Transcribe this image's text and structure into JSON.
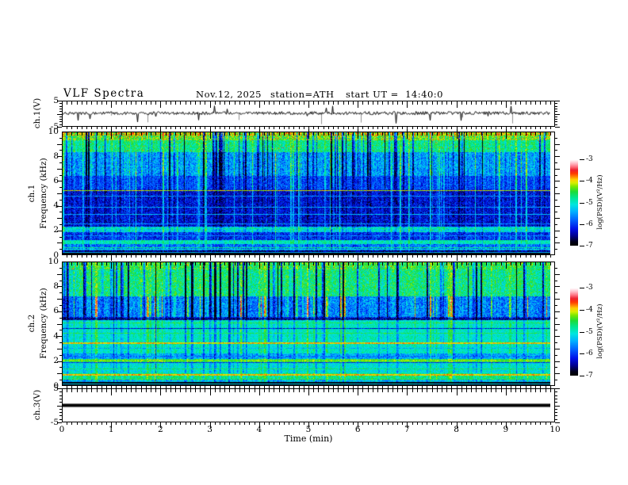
{
  "header": {
    "title": "VLF Spectra",
    "date": "Nov.12, 2025",
    "station": "station=ATH",
    "start_ut": "start UT =  14:40:0"
  },
  "x_axis": {
    "label": "Time (min)",
    "min": 0,
    "max": 10,
    "ticks": [
      "0",
      "1",
      "2",
      "3",
      "4",
      "5",
      "6",
      "7",
      "8",
      "9",
      "10"
    ],
    "minor_step_min": 0.1
  },
  "colormap": {
    "vmin": -7,
    "vmax": -3,
    "stops": [
      {
        "t": 0.0,
        "c": "#000000"
      },
      {
        "t": 0.05,
        "c": "#000018"
      },
      {
        "t": 0.12,
        "c": "#000090"
      },
      {
        "t": 0.2,
        "c": "#0010e8"
      },
      {
        "t": 0.3,
        "c": "#0060ff"
      },
      {
        "t": 0.4,
        "c": "#00b2ff"
      },
      {
        "t": 0.48,
        "c": "#00e6e0"
      },
      {
        "t": 0.56,
        "c": "#00e690"
      },
      {
        "t": 0.63,
        "c": "#1ddc35"
      },
      {
        "t": 0.69,
        "c": "#7ae800"
      },
      {
        "t": 0.73,
        "c": "#d6ef00"
      },
      {
        "t": 0.77,
        "c": "#ffd000"
      },
      {
        "t": 0.8,
        "c": "#ff8c00"
      },
      {
        "t": 0.84,
        "c": "#ff3800"
      },
      {
        "t": 0.88,
        "c": "#ee1f2e"
      },
      {
        "t": 0.92,
        "c": "#ff7584"
      },
      {
        "t": 0.96,
        "c": "#ffc0cb"
      },
      {
        "t": 1.0,
        "c": "#ffffff"
      }
    ]
  },
  "colorbars": [
    {
      "label": "log(PSD)(V²/Hz)",
      "ticks": [
        "-3",
        "-4",
        "-5",
        "-6",
        "-7"
      ]
    },
    {
      "label": "log(PSD)(V²/Hz)",
      "ticks": [
        "-3",
        "-4",
        "-5",
        "-6",
        "-7"
      ]
    }
  ],
  "chart_data": [
    {
      "type": "line",
      "name": "ch1 voltage waveform",
      "ylabel": "ch.1(V)",
      "ylim": [
        -5,
        5
      ],
      "y_tick_labels": [
        {
          "v": 5,
          "label": "5"
        },
        {
          "v": -5,
          "label": "-5"
        }
      ],
      "x_range_min": [
        0,
        9.89
      ],
      "signal": {
        "seed": 7,
        "baseline": 0.25,
        "noise_amplitude": 0.65,
        "spike_down_prob": 0.012,
        "spike_down_max": 4.3,
        "spike_up_prob": 0.006,
        "spike_up_max": 2.4,
        "gray_spike_prob": 0.01,
        "gray_spike_max": 3.2,
        "line_color": "#000000",
        "gray_color": "#909090"
      }
    },
    {
      "type": "heatmap",
      "name": "ch1 spectrogram",
      "ylabel": [
        "ch.1",
        "Frequency (kHz)"
      ],
      "ylim": [
        0,
        10
      ],
      "freq_max": 10,
      "y_tick_labels": [
        {
          "v": 10,
          "label": "10"
        },
        {
          "v": 8,
          "label": "8"
        },
        {
          "v": 6,
          "label": "6"
        },
        {
          "v": 4,
          "label": "4"
        },
        {
          "v": 2,
          "label": "2"
        },
        {
          "v": 0,
          "label": "0"
        }
      ],
      "zlabel": "log(PSD)(V²/Hz)",
      "zlim": [
        -7,
        -3
      ],
      "seed": 1234,
      "streaks": {
        "probability": 0.34,
        "max_width": 2,
        "max_strength": 2.3,
        "dark_fraction": 0.55
      },
      "bands": [
        {
          "f": [
            9.75,
            10.01
          ],
          "base": -4.05,
          "noise": 0.5,
          "sd": -1.15,
          "sb": 0.1,
          "hot": 0.12
        },
        {
          "f": [
            9.35,
            9.75
          ],
          "base": -4.3,
          "noise": 0.45,
          "sd": -1.1,
          "sb": 0.12,
          "hot": 0.05
        },
        {
          "f": [
            8.35,
            9.35
          ],
          "base": -4.7,
          "noise": 0.4,
          "sd": -1.05,
          "sb": 0.15,
          "hot": 0.01
        },
        {
          "f": [
            6.4,
            8.35
          ],
          "base": -5.5,
          "noise": 0.5,
          "sd": -0.8,
          "sb": 0.55
        },
        {
          "f": [
            5.3,
            6.4
          ],
          "base": -5.95,
          "noise": 0.42,
          "sd": -0.35,
          "sb": 0.6
        },
        {
          "f": [
            2.3,
            5.3
          ],
          "base": -6.28,
          "noise": 0.42,
          "sd": -0.18,
          "sb": 0.5
        },
        {
          "f": [
            1.8,
            2.3
          ],
          "base": -5.15,
          "noise": 0.45,
          "sd": -0.3,
          "sb": 0.35
        },
        {
          "f": [
            1.15,
            1.8
          ],
          "base": -6.05,
          "noise": 0.45,
          "sd": -0.15,
          "sb": 0.45
        },
        {
          "f": [
            0.85,
            1.15
          ],
          "base": -4.9,
          "noise": 0.3,
          "sd": -0.2,
          "sb": 0.15
        },
        {
          "f": [
            0.3,
            0.85
          ],
          "base": -5.7,
          "noise": 0.5,
          "sd": -0.2,
          "sb": 0.3
        },
        {
          "f": [
            0.1,
            0.3
          ],
          "base": -6.6,
          "noise": 0.35,
          "sd": 0,
          "sb": 0.2
        },
        {
          "f": [
            -0.01,
            0.1
          ],
          "base": -6.95,
          "noise": 0.08,
          "sd": 0,
          "sb": 0
        }
      ],
      "lines": [
        {
          "f": 5.2,
          "v": -4.1,
          "w": 1,
          "noise": 0.3
        },
        {
          "f": 4.75,
          "v": -5.55,
          "w": 1,
          "noise": 0.3
        },
        {
          "f": 3.85,
          "v": -5.45,
          "w": 1,
          "noise": 0.3
        },
        {
          "f": 3.3,
          "v": -5.35,
          "w": 1,
          "noise": 0.3
        },
        {
          "f": 2.5,
          "v": -5.55,
          "w": 1,
          "noise": 0.3
        },
        {
          "f": 2.1,
          "v": -4.8,
          "w": 1,
          "noise": 0.3
        },
        {
          "f": 1.55,
          "v": -5.6,
          "w": 1,
          "noise": 0.3
        },
        {
          "f": 0.55,
          "v": -4.75,
          "w": 1,
          "noise": 0.3
        },
        {
          "f": 0.42,
          "v": -5.05,
          "w": 1,
          "noise": 0.3
        },
        {
          "f": 0.18,
          "v": -5.4,
          "w": 1,
          "noise": 0.3
        }
      ]
    },
    {
      "type": "heatmap",
      "name": "ch2 spectrogram",
      "ylabel": [
        "ch.2",
        "Frequency (kHz)"
      ],
      "ylim": [
        0,
        10
      ],
      "freq_max": 10,
      "y_tick_labels": [
        {
          "v": 10,
          "label": "10"
        },
        {
          "v": 8,
          "label": "8"
        },
        {
          "v": 6,
          "label": "6"
        },
        {
          "v": 4,
          "label": "4"
        },
        {
          "v": 2,
          "label": "2"
        },
        {
          "v": 0,
          "label": "0"
        }
      ],
      "zlabel": "log(PSD)(V²/Hz)",
      "zlim": [
        -7,
        -3
      ],
      "seed": 5678,
      "streaks": {
        "probability": 0.3,
        "max_width": 3,
        "max_strength": 2.7,
        "dark_fraction": 0.62
      },
      "bands": [
        {
          "f": [
            9.4,
            10.01
          ],
          "base": -4.45,
          "noise": 0.4,
          "sd": -1.2,
          "sb": 0.1,
          "hot": 0.02
        },
        {
          "f": [
            7.2,
            9.4
          ],
          "base": -4.65,
          "noise": 0.45,
          "sd": -1.25,
          "sb": 0.12
        },
        {
          "f": [
            5.55,
            7.2
          ],
          "base": -5.6,
          "noise": 0.5,
          "sd": -0.7,
          "sb": 0.8
        },
        {
          "f": [
            5.28,
            5.55
          ],
          "base": -6.2,
          "noise": 0.5,
          "sd": -0.25,
          "sb": 0.3
        },
        {
          "f": [
            2.55,
            5.28
          ],
          "base": -4.95,
          "noise": 0.3,
          "sd": -0.4,
          "sb": 0.22
        },
        {
          "f": [
            2.15,
            2.55
          ],
          "base": -5.45,
          "noise": 0.4,
          "sd": -0.3,
          "sb": 0.25
        },
        {
          "f": [
            1.85,
            2.15
          ],
          "base": -4.5,
          "noise": 0.3,
          "sd": -0.35,
          "sb": 0.18
        },
        {
          "f": [
            0.95,
            1.85
          ],
          "base": -5.05,
          "noise": 0.35,
          "sd": -0.3,
          "sb": 0.2
        },
        {
          "f": [
            0.5,
            0.95
          ],
          "base": -4.7,
          "noise": 0.35,
          "sd": -0.25,
          "sb": 0.18
        },
        {
          "f": [
            0.25,
            0.5
          ],
          "base": -5.3,
          "noise": 0.5,
          "sd": -0.2,
          "sb": 0.2
        },
        {
          "f": [
            -0.01,
            0.25
          ],
          "base": -6.9,
          "noise": 0.12,
          "sd": 0,
          "sb": 0
        }
      ],
      "lines": [
        {
          "f": 5.4,
          "v": -6.7,
          "w": 1,
          "noise": 0.3
        },
        {
          "f": 5.05,
          "v": -4.55,
          "w": 1,
          "noise": 0.3
        },
        {
          "f": 4.6,
          "v": -6.2,
          "w": 1,
          "noise": 0.4
        },
        {
          "f": 4.2,
          "v": -4.55,
          "w": 1,
          "noise": 0.3
        },
        {
          "f": 3.4,
          "v": -3.95,
          "w": 2,
          "noise": 0.3
        },
        {
          "f": 3.0,
          "v": -5.35,
          "w": 1,
          "noise": 0.4
        },
        {
          "f": 2.35,
          "v": -5.6,
          "w": 2,
          "noise": 0.45
        },
        {
          "f": 2.0,
          "v": -4.3,
          "w": 2,
          "noise": 0.3
        },
        {
          "f": 1.85,
          "v": -6.0,
          "w": 1,
          "noise": 0.3
        },
        {
          "f": 1.3,
          "v": -4.6,
          "w": 1,
          "noise": 0.3
        },
        {
          "f": 0.83,
          "v": -3.9,
          "w": 2,
          "noise": 0.25
        },
        {
          "f": 0.5,
          "v": -4.5,
          "w": 1,
          "noise": 0.3
        },
        {
          "f": 0.12,
          "v": -5.2,
          "w": 1,
          "noise": 0.3
        }
      ]
    },
    {
      "type": "line",
      "name": "ch3 voltage waveform",
      "ylabel": "ch.3(V)",
      "ylim": [
        -5,
        5
      ],
      "y_tick_labels": [
        {
          "v": 5,
          "label": "5"
        },
        {
          "v": -5,
          "label": "-5"
        }
      ],
      "x_range_min": [
        0,
        9.89
      ],
      "signal": {
        "constant": 0,
        "line_thickness_px": 4,
        "line_color": "#000000"
      }
    }
  ]
}
